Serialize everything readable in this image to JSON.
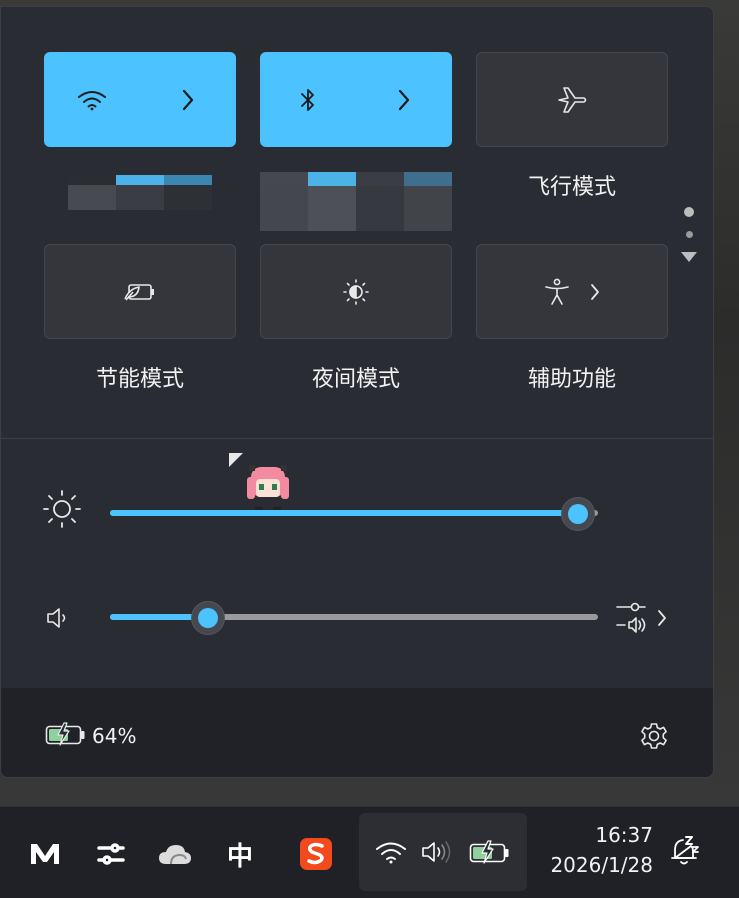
{
  "quick_settings": {
    "tiles": [
      {
        "id": "wifi",
        "icon": "wifi-icon",
        "state": "on",
        "has_arrow": true
      },
      {
        "id": "bluetooth",
        "icon": "bluetooth-icon",
        "state": "on",
        "has_arrow": true
      },
      {
        "id": "airplane",
        "icon": "airplane-icon",
        "state": "off",
        "label": "飞行模式"
      },
      {
        "id": "battery_saver",
        "icon": "battery-saver-icon",
        "state": "off",
        "label": "节能模式"
      },
      {
        "id": "night_light",
        "icon": "night-light-icon",
        "state": "off",
        "label": "夜间模式"
      },
      {
        "id": "accessibility",
        "icon": "accessibility-icon",
        "state": "off",
        "has_arrow": true,
        "label": "辅助功能"
      }
    ],
    "labels": {
      "airplane": "飞行模式",
      "battery_saver": "节能模式",
      "night_light": "夜间模式",
      "accessibility": "辅助功能"
    },
    "brightness": {
      "icon": "sun-icon",
      "level": 0.96
    },
    "volume": {
      "icon": "speaker-icon",
      "level": 0.2,
      "output_icon": "audio-output-icon"
    },
    "battery": {
      "icon": "battery-charging-icon",
      "percent_text": "64%"
    },
    "settings_icon": "gear-icon",
    "accent_color": "#4cc2ff"
  },
  "taskbar": {
    "apps": [
      "app-m-icon",
      "sliders-icon",
      "cloud-icon",
      "ime-icon",
      "sogou-icon"
    ],
    "ime_label": "中",
    "tray": [
      "wifi-icon",
      "speaker-icon",
      "battery-charging-icon"
    ],
    "time": "16:37",
    "date": "2026/1/28",
    "notification_icon": "notification-snooze-icon"
  }
}
